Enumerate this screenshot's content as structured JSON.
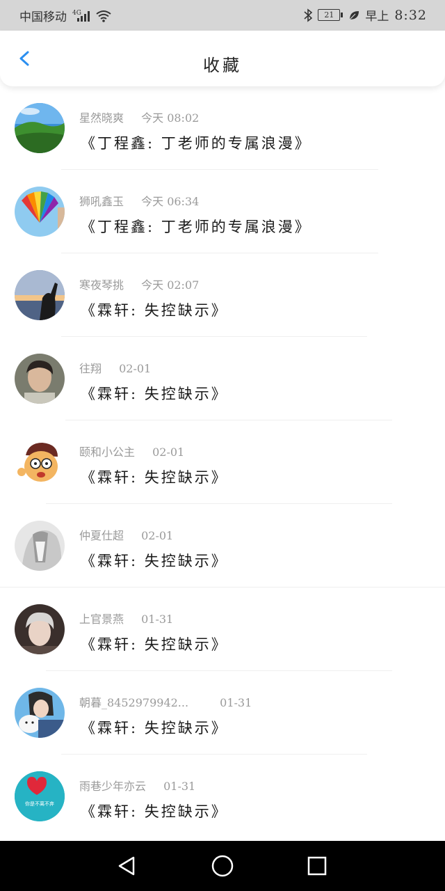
{
  "status_bar": {
    "carrier": "中国移动",
    "network": "4G",
    "battery": "21",
    "ampm": "早上",
    "time": "8:32"
  },
  "header": {
    "title": "收藏",
    "back_icon": "chevron-left-icon"
  },
  "favorites": [
    {
      "user": "星然晓爽",
      "time": "今天 08:02",
      "title": "《丁程鑫: 丁老师的专属浪漫》"
    },
    {
      "user": "狮吼鑫玉",
      "time": "今天 06:34",
      "title": "《丁程鑫: 丁老师的专属浪漫》"
    },
    {
      "user": "寒夜琴挑",
      "time": "今天 02:07",
      "title": "《霖轩: 失控缺示》"
    },
    {
      "user": "往翔",
      "time": "02-01",
      "title": "《霖轩: 失控缺示》"
    },
    {
      "user": "颐和小公主",
      "time": "02-01",
      "title": "《霖轩: 失控缺示》"
    },
    {
      "user": "仲夏仕超",
      "time": "02-01",
      "title": "《霖轩: 失控缺示》"
    },
    {
      "user": "上官景燕",
      "time": "01-31",
      "title": "《霖轩: 失控缺示》"
    },
    {
      "user": "朝暮_8452979942...",
      "time": "01-31",
      "title": "《霖轩: 失控缺示》"
    },
    {
      "user": "雨巷少年亦云",
      "time": "01-31",
      "title": "《霖轩: 失控缺示》"
    }
  ],
  "avatar_overlay_text": "你是不离不弃",
  "colors": {
    "accent": "#2b8ff0",
    "status_bar_bg": "#d6d6d6",
    "nav_bar_bg": "#000000",
    "meta_text": "#9a9a9a"
  },
  "nav_bar": {
    "back_icon": "triangle-back-icon",
    "home_icon": "circle-home-icon",
    "recents_icon": "square-recents-icon"
  }
}
